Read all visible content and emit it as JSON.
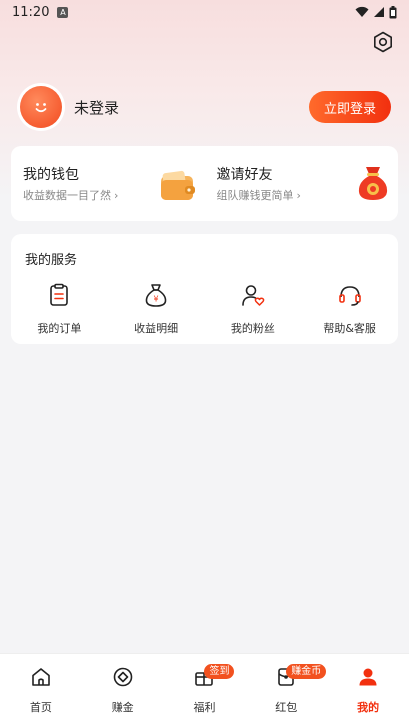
{
  "status_bar": {
    "time": "11:20"
  },
  "profile": {
    "login_status": "未登录",
    "login_button": "立即登录"
  },
  "wallet_card": {
    "wallet": {
      "title": "我的钱包",
      "subtitle": "收益数据一目了然"
    },
    "invite": {
      "title": "邀请好友",
      "subtitle": "组队赚钱更简单"
    }
  },
  "services": {
    "title": "我的服务",
    "items": [
      {
        "label": "我的订单",
        "icon": "order-icon"
      },
      {
        "label": "收益明细",
        "icon": "money-bag-icon"
      },
      {
        "label": "我的粉丝",
        "icon": "fans-icon"
      },
      {
        "label": "帮助&客服",
        "icon": "headset-icon"
      }
    ]
  },
  "tabbar": {
    "items": [
      {
        "label": "首页",
        "icon": "home-icon"
      },
      {
        "label": "赚金",
        "icon": "coin-icon"
      },
      {
        "label": "福利",
        "icon": "gift-icon",
        "badge": "签到"
      },
      {
        "label": "红包",
        "icon": "red-packet-icon",
        "badge": "赚金币"
      },
      {
        "label": "我的",
        "icon": "user-icon",
        "active": true
      }
    ]
  },
  "colors": {
    "accent": "#f2300f",
    "accent_light": "#ff6a2b",
    "badge": "#f2511f"
  }
}
